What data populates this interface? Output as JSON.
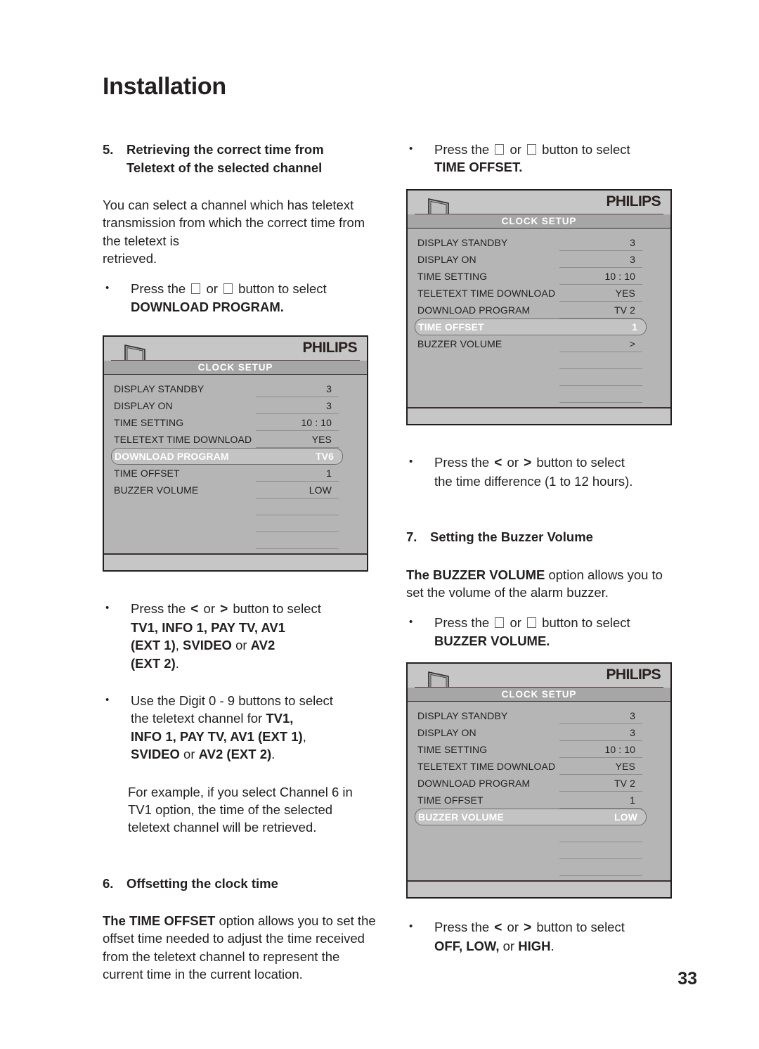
{
  "page": {
    "title": "Installation",
    "number": "33"
  },
  "left_column": {
    "section5": {
      "number": "5.",
      "title_line1": "Retrieving the correct time from",
      "title_line2": "Teletext of the selected channel"
    },
    "intro_paragraph": "You can select a channel which has teletext transmission from which the correct time from the teletext is\nretrieved.",
    "bullet_download": {
      "prefix": "Press the",
      "middle": "or",
      "suffix": "button to select",
      "target": "DOWNLOAD PROGRAM."
    },
    "osd1": {
      "brand": "PHILIPS",
      "subtitle": "CLOCK SETUP",
      "rows": [
        {
          "label": "DISPLAY STANDBY",
          "value": "3",
          "selected": false
        },
        {
          "label": "DISPLAY ON",
          "value": "3",
          "selected": false
        },
        {
          "label": "TIME SETTING",
          "value": "10 : 10",
          "selected": false
        },
        {
          "label": "TELETEXT TIME DOWNLOAD",
          "value": "YES",
          "selected": false
        },
        {
          "label": "DOWNLOAD PROGRAM",
          "value": "TV6",
          "selected": true
        },
        {
          "label": "TIME OFFSET",
          "value": "1",
          "selected": false
        },
        {
          "label": "BUZZER VOLUME",
          "value": "LOW",
          "selected": false
        },
        {
          "label": "",
          "value": "",
          "selected": false
        },
        {
          "label": "",
          "value": "",
          "selected": false
        },
        {
          "label": "",
          "value": "",
          "selected": false
        }
      ]
    },
    "bullet_source": {
      "prefix": "Press the",
      "left_arrow": "<",
      "middle": "or",
      "right_arrow": ">",
      "suffix": "button to select",
      "line2": "TV1, INFO 1, PAY TV, AV1",
      "line3_a": "(EXT 1)",
      "line3_b": ", ",
      "line3_c": "SVIDEO",
      "line3_d": " or ",
      "line3_e": "AV2",
      "line4_a": "(EXT 2)",
      "line4_b": "."
    },
    "bullet_digit": {
      "line1": "Use the Digit 0 - 9 buttons to select",
      "line2_plain": "the teletext channel for ",
      "line2_bold": "TV1,",
      "line3_bold": "INFO 1, PAY TV, AV1 (EXT 1)",
      "line3_plain": ",",
      "line4_bold": "SVIDEO",
      "line4_plain": " or ",
      "line4_bold2": "AV2 (EXT 2)",
      "line4_end": "."
    },
    "example_paragraph": "For example, if you select Channel 6 in TV1 option, the time of the selected teletext channel will be retrieved.",
    "section6": {
      "number": "6.",
      "title": "Offsetting the clock time"
    },
    "offset_paragraph": {
      "lead": "The ",
      "bold": "TIME OFFSET",
      "rest": " option allows you to set the offset time needed to adjust the time received from the teletext channel to represent the current time in the current location."
    }
  },
  "right_column": {
    "bullet_timeoffset": {
      "prefix": "Press the",
      "middle": "or",
      "suffix": "button to select",
      "target": "TIME OFFSET."
    },
    "osd2": {
      "brand": "PHILIPS",
      "subtitle": "CLOCK SETUP",
      "rows": [
        {
          "label": "DISPLAY STANDBY",
          "value": "3",
          "selected": false
        },
        {
          "label": "DISPLAY ON",
          "value": "3",
          "selected": false
        },
        {
          "label": "TIME SETTING",
          "value": "10 : 10",
          "selected": false
        },
        {
          "label": "TELETEXT TIME DOWNLOAD",
          "value": "YES",
          "selected": false
        },
        {
          "label": "DOWNLOAD PROGRAM",
          "value": "TV 2",
          "selected": false
        },
        {
          "label": "TIME OFFSET",
          "value": "1",
          "selected": true
        },
        {
          "label": "BUZZER VOLUME",
          "value": ">",
          "selected": false
        },
        {
          "label": "",
          "value": "",
          "selected": false
        },
        {
          "label": "",
          "value": "",
          "selected": false
        },
        {
          "label": "",
          "value": "",
          "selected": false
        }
      ]
    },
    "bullet_timediff": {
      "prefix": "Press the",
      "left_arrow": "<",
      "middle": "or",
      "right_arrow": ">",
      "suffix": "button to select",
      "line2": "the time difference (1 to 12 hours)."
    },
    "section7": {
      "number": "7.",
      "title": "Setting the Buzzer Volume"
    },
    "buzzer_paragraph": {
      "lead": "The ",
      "bold": "BUZZER VOLUME",
      "rest": " option allows you to set the volume of the alarm buzzer."
    },
    "bullet_buzzer": {
      "prefix": "Press the",
      "middle": "or",
      "suffix": "button to select",
      "target": "BUZZER VOLUME."
    },
    "osd3": {
      "brand": "PHILIPS",
      "subtitle": "CLOCK SETUP",
      "rows": [
        {
          "label": "DISPLAY STANDBY",
          "value": "3",
          "selected": false
        },
        {
          "label": "DISPLAY ON",
          "value": "3",
          "selected": false
        },
        {
          "label": "TIME SETTING",
          "value": "10 : 10",
          "selected": false
        },
        {
          "label": "TELETEXT TIME DOWNLOAD",
          "value": "YES",
          "selected": false
        },
        {
          "label": "DOWNLOAD PROGRAM",
          "value": "TV 2",
          "selected": false
        },
        {
          "label": "TIME OFFSET",
          "value": "1",
          "selected": false
        },
        {
          "label": "BUZZER VOLUME",
          "value": "LOW",
          "selected": true
        },
        {
          "label": "",
          "value": "",
          "selected": false
        },
        {
          "label": "",
          "value": "",
          "selected": false
        },
        {
          "label": "",
          "value": "",
          "selected": false
        }
      ]
    },
    "bullet_offlowhigh": {
      "prefix": "Press the",
      "left_arrow": "<",
      "middle": "or",
      "right_arrow": ">",
      "suffix": "button to select",
      "line2_a": "OFF, LOW,",
      "line2_b": " or ",
      "line2_c": "HIGH",
      "line2_d": "."
    }
  },
  "colors": {
    "text": "#231f20",
    "osd_background": "#b5b5b5",
    "osd_header": "#c6c6c6",
    "osd_subtitle_band": "#a6a6a6",
    "osd_selected": "#c3c3c3",
    "osd_rule": "#5e4040"
  }
}
